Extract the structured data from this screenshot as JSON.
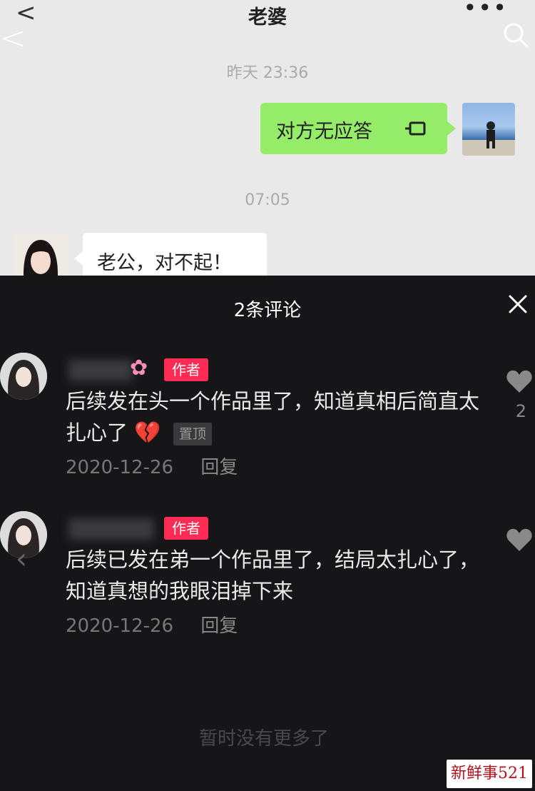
{
  "chat": {
    "title": "老婆",
    "more_label": "•••",
    "back_glyph": "<",
    "timestamp_1": "昨天 23:36",
    "outgoing_message": "对方无应答",
    "timestamp_2": "07:05",
    "incoming_message": "老公，对不起！",
    "colors": {
      "outgoing_bubble": "#95ec69",
      "incoming_bubble": "#ffffff",
      "background": "#e9e9e9"
    }
  },
  "comments_panel": {
    "title": "2条评论",
    "footer": "暂时没有更多了",
    "colors": {
      "background": "#161618",
      "author_badge": "#fe2c55"
    },
    "comments": [
      {
        "author_badge": "作者",
        "text": "后续发在头一个作品里了，知道真相后简直太扎心了",
        "emoji": "💔",
        "pinned_label": "置顶",
        "date": "2020-12-26",
        "reply_label": "回复",
        "like_count": "2",
        "icons": [
          "flower-icon",
          "broken-heart-icon",
          "heart-icon"
        ]
      },
      {
        "author_badge": "作者",
        "text": "后续已发在弟一个作品里了，结局太扎心了，知道真想的我眼泪掉下来",
        "date": "2020-12-26",
        "reply_label": "回复",
        "icons": [
          "heart-icon"
        ]
      }
    ]
  },
  "watermark": "新鲜事521"
}
